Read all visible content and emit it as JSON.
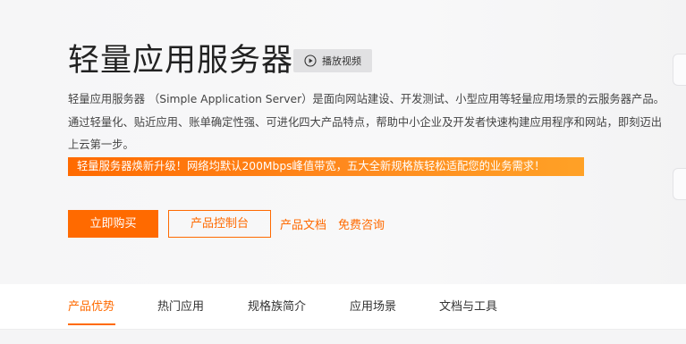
{
  "hero": {
    "title": "轻量应用服务器",
    "video_button_label": "播放视频",
    "description": "轻量应用服务器 （Simple Application Server）是面向网站建设、开发测试、小型应用等轻量应用场景的云服务器产品。通过轻量化、贴近应用、账单确定性强、可进化四大产品特点，帮助中小企业及开发者快速构建应用程序和网站，即刻迈出上云第一步。",
    "promo_text": "轻量服务器焕新升级！网络均默认200Mbps峰值带宽，五大全新规格族轻松适配您的业务需求！",
    "buy_button_label": "立即购买",
    "console_button_label": "产品控制台",
    "docs_link_label": "产品文档",
    "consult_link_label": "免费咨询"
  },
  "tabs": [
    {
      "label": "产品优势",
      "active": true
    },
    {
      "label": "热门应用",
      "active": false
    },
    {
      "label": "规格族简介",
      "active": false
    },
    {
      "label": "应用场景",
      "active": false
    },
    {
      "label": "文档与工具",
      "active": false
    }
  ],
  "colors": {
    "accent": "#ff6a00",
    "background": "#f7f7f8",
    "video_button_bg": "#e1e1e3"
  },
  "icons": {
    "play": "play-circle-icon"
  }
}
